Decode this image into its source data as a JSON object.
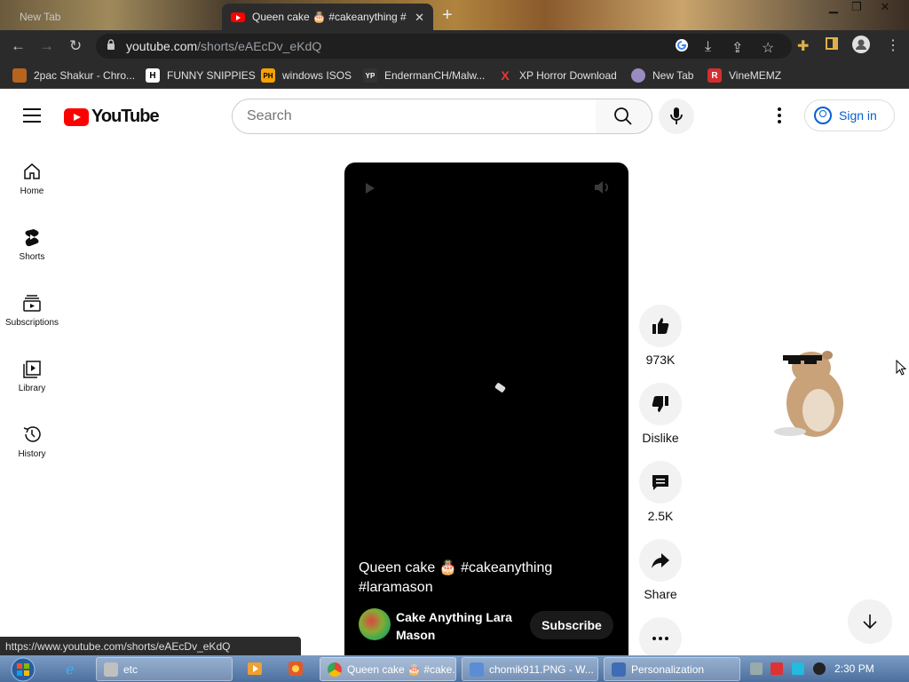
{
  "browser": {
    "tabs": [
      {
        "label": "New Tab",
        "active": false
      },
      {
        "label": "Queen cake 🎂 #cakeanything #",
        "active": true
      }
    ],
    "new_tab_symbol": "+",
    "close_symbol": "✕",
    "url_host": "youtube.com",
    "url_path": "/shorts/eAEcDv_eKdQ",
    "bookmarks": [
      {
        "label": "2pac Shakur - Chro...",
        "icon_color": "#b5651d"
      },
      {
        "label": "FUNNY SNIPPIES",
        "icon_text": "H",
        "icon_color": "#ffffff"
      },
      {
        "label": "windows ISOS",
        "icon_text": "PH",
        "icon_color": "#f7a200"
      },
      {
        "label": "EndermanCH/Malw...",
        "icon_text": "YP",
        "icon_color": "#333333"
      },
      {
        "label": "XP Horror Download",
        "icon_text": "X",
        "icon_color": "#e53935"
      },
      {
        "label": "New Tab",
        "icon_color": "#9a8cc0"
      },
      {
        "label": "VineMEMZ",
        "icon_text": "R",
        "icon_color": "#d32f2f"
      }
    ],
    "status_url": "https://www.youtube.com/shorts/eAEcDv_eKdQ"
  },
  "youtube": {
    "logo_text": "YouTube",
    "search_placeholder": "Search",
    "sign_in": "Sign in",
    "sidebar": [
      {
        "label": "Home",
        "icon": "home-icon"
      },
      {
        "label": "Shorts",
        "icon": "shorts-icon"
      },
      {
        "label": "Subscriptions",
        "icon": "subscriptions-icon"
      },
      {
        "label": "Library",
        "icon": "library-icon"
      },
      {
        "label": "History",
        "icon": "history-icon"
      }
    ],
    "short": {
      "title": "Queen cake 🎂 #cakeanything #laramason",
      "channel": "Cake Anything Lara Mason",
      "subscribe": "Subscribe"
    },
    "actions": {
      "likes": "973K",
      "dislike": "Dislike",
      "comments": "2.5K",
      "share": "Share"
    },
    "accent_color": "#ff0000",
    "link_color": "#065fd4"
  },
  "taskbar": {
    "items": [
      {
        "label": "etc",
        "icon_color": "#c0c0c0"
      },
      {
        "label": "Queen cake 🎂 #cake...",
        "icon_color": "#4caf50"
      },
      {
        "label": "chomik911.PNG - W...",
        "icon_color": "#5b8dd6"
      },
      {
        "label": "Personalization",
        "icon_color": "#3f6db5"
      }
    ],
    "clock": "2:30 PM"
  }
}
